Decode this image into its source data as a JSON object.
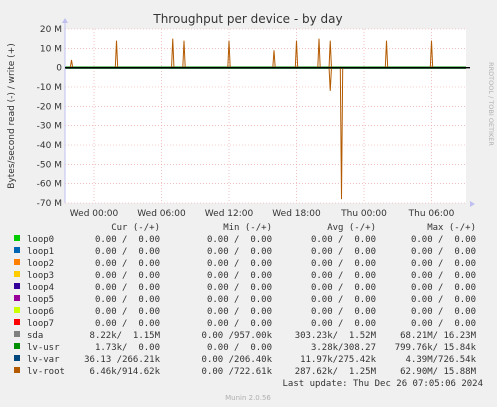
{
  "colors": {
    "background": "#f0f0f0",
    "plot_background": "#ffffff",
    "grid_major": "#e89c9c",
    "grid_minor": "#d8d8d8",
    "axis": "#333333",
    "text": "#333333",
    "watermark": "#b0b0b0"
  },
  "chart_data": {
    "type": "line",
    "title": "Throughput per device - by day",
    "ylabel": "Bytes/second read (-) / write (+)",
    "ylim": [
      -70000000,
      20000000
    ],
    "yticks": [
      {
        "value": 20000000,
        "label": "20 M"
      },
      {
        "value": 10000000,
        "label": "10 M"
      },
      {
        "value": 0,
        "label": "0"
      },
      {
        "value": -10000000,
        "label": "-10 M"
      },
      {
        "value": -20000000,
        "label": "-20 M"
      },
      {
        "value": -30000000,
        "label": "-30 M"
      },
      {
        "value": -40000000,
        "label": "-40 M"
      },
      {
        "value": -50000000,
        "label": "-50 M"
      },
      {
        "value": -60000000,
        "label": "-60 M"
      },
      {
        "value": -70000000,
        "label": "-70 M"
      }
    ],
    "xlim": [
      "Wed 21:06",
      "Thu 07:06"
    ],
    "xticks": [
      "Wed 00:00",
      "Wed 06:00",
      "Wed 12:00",
      "Wed 18:00",
      "Thu 00:00",
      "Thu 06:00"
    ],
    "grid": true,
    "series": [
      {
        "name": "lv-root",
        "color": "#b35a00",
        "spikes_write": [
          {
            "time": "Tue 22:00",
            "value": 4000000
          },
          {
            "time": "Wed 02:00",
            "value": 14000000
          },
          {
            "time": "Wed 07:00",
            "value": 15000000
          },
          {
            "time": "Wed 08:00",
            "value": 14000000
          },
          {
            "time": "Wed 12:00",
            "value": 14000000
          },
          {
            "time": "Wed 16:00",
            "value": 9000000
          },
          {
            "time": "Wed 18:00",
            "value": 14000000
          },
          {
            "time": "Wed 20:00",
            "value": 15000000
          },
          {
            "time": "Wed 21:00",
            "value": 14000000
          },
          {
            "time": "Thu 02:00",
            "value": 14000000
          },
          {
            "time": "Thu 06:00",
            "value": 14000000
          }
        ],
        "spikes_read": [
          {
            "time": "Wed 21:00",
            "value": -12000000
          },
          {
            "time": "Wed 22:00",
            "value": -68000000
          }
        ]
      },
      {
        "name": "sda",
        "color": "#008f00"
      },
      {
        "name": "lv-var",
        "color": "#00455a"
      },
      {
        "name": "lv-usr",
        "color": "#006b2e"
      }
    ]
  },
  "legend": {
    "headers": {
      "cur": "Cur (-/+)",
      "min": "Min (-/+)",
      "avg": "Avg (-/+)",
      "max": "Max (-/+)"
    },
    "rows": [
      {
        "name": "loop0",
        "color": "#00cc00",
        "cur": "0.00 /  0.00",
        "min": "0.00 /  0.00",
        "avg": "0.00 /  0.00",
        "max": "0.00 /  0.00"
      },
      {
        "name": "loop1",
        "color": "#0066b3",
        "cur": "0.00 /  0.00",
        "min": "0.00 /  0.00",
        "avg": "0.00 /  0.00",
        "max": "0.00 /  0.00"
      },
      {
        "name": "loop2",
        "color": "#ff8000",
        "cur": "0.00 /  0.00",
        "min": "0.00 /  0.00",
        "avg": "0.00 /  0.00",
        "max": "0.00 /  0.00"
      },
      {
        "name": "loop3",
        "color": "#ffcc00",
        "cur": "0.00 /  0.00",
        "min": "0.00 /  0.00",
        "avg": "0.00 /  0.00",
        "max": "0.00 /  0.00"
      },
      {
        "name": "loop4",
        "color": "#330099",
        "cur": "0.00 /  0.00",
        "min": "0.00 /  0.00",
        "avg": "0.00 /  0.00",
        "max": "0.00 /  0.00"
      },
      {
        "name": "loop5",
        "color": "#990099",
        "cur": "0.00 /  0.00",
        "min": "0.00 /  0.00",
        "avg": "0.00 /  0.00",
        "max": "0.00 /  0.00"
      },
      {
        "name": "loop6",
        "color": "#ccff00",
        "cur": "0.00 /  0.00",
        "min": "0.00 /  0.00",
        "avg": "0.00 /  0.00",
        "max": "0.00 /  0.00"
      },
      {
        "name": "loop7",
        "color": "#ff0000",
        "cur": "0.00 /  0.00",
        "min": "0.00 /  0.00",
        "avg": "0.00 /  0.00",
        "max": "0.00 /  0.00"
      },
      {
        "name": "sda",
        "color": "#808080",
        "cur": "8.22k/  1.15M",
        "min": "0.00 /957.00k",
        "avg": "303.23k/  1.52M",
        "max": "68.21M/ 16.23M"
      },
      {
        "name": "lv-usr",
        "color": "#008f00",
        "cur": "1.73k/  0.00",
        "min": "0.00 /  0.00",
        "avg": "3.28k/308.27",
        "max": "799.76k/ 15.84k"
      },
      {
        "name": "lv-var",
        "color": "#00487d",
        "cur": "36.13 /266.21k",
        "min": "0.00 /206.40k",
        "avg": "11.97k/275.42k",
        "max": "4.39M/726.54k"
      },
      {
        "name": "lv-root",
        "color": "#b35a00",
        "cur": "6.46k/914.62k",
        "min": "0.00 /722.61k",
        "avg": "287.62k/  1.25M",
        "max": "62.90M/ 15.88M"
      }
    ]
  },
  "last_update": "Last update: Thu Dec 26 07:05:06 2024",
  "watermark": "RRDTOOL / TOBI OETIKER",
  "footer": "Munin 2.0.56"
}
